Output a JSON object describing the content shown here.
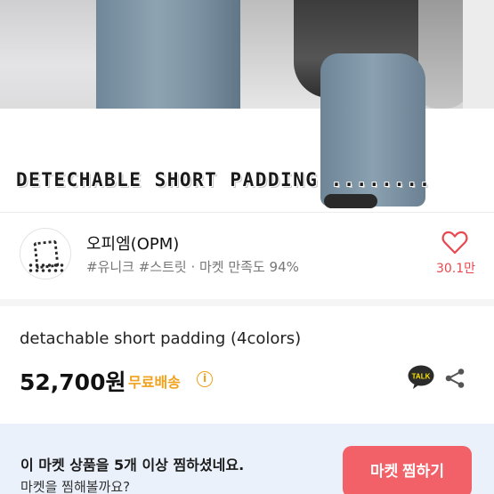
{
  "hero": {
    "title": "DETECHABLE SHORT PADDING ........"
  },
  "shop": {
    "name": "오피엠(OPM)",
    "tags": "#유니크 #스트릿 · 마켓 만족도 94%",
    "like_count": "30.1만",
    "like_icon": "heart-outline-icon"
  },
  "product": {
    "title": "detachable short padding (4colors)",
    "price": "52,700원",
    "shipping_label": "무료배송",
    "info_symbol": "i",
    "talk_label": "TALK"
  },
  "banner": {
    "line1": "이 마켓 상품을 5개 이상 찜하셨네요.",
    "line2": "마켓을 찜해볼까요?",
    "button_label": "마켓 찜하기"
  },
  "colors": {
    "accent": "#f26168",
    "like": "#e8484f",
    "shipping": "#f0a21c",
    "banner_bg": "#eaf1fb"
  }
}
